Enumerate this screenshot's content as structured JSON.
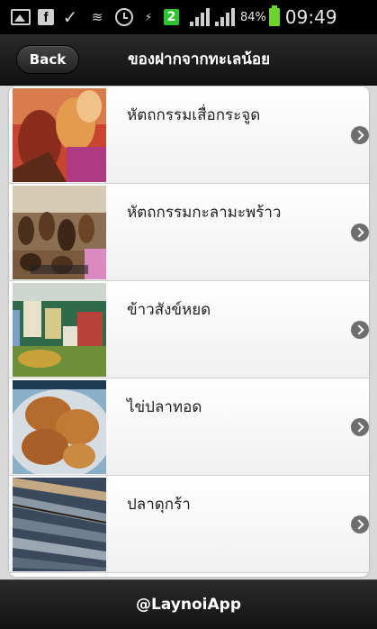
{
  "status_bar": {
    "icons": [
      "gallery-icon",
      "facebook-icon",
      "check-icon",
      "wifi-icon",
      "alarm-icon",
      "charging-icon",
      "notification-2-icon",
      "signal-icon",
      "signal-icon"
    ],
    "notification_count": "2",
    "fb_glyph": "f",
    "battery_percent": "84%",
    "time": "09:49"
  },
  "header": {
    "back_label": "Back",
    "title": "ของฝากจากทะเลน้อย"
  },
  "items": [
    {
      "label": "หัตถกรรมเสื่อกระจูด",
      "thumb": "woven-crafts"
    },
    {
      "label": "หัตถกรรมกะลามะพร้าว",
      "thumb": "coconut-shell-crafts"
    },
    {
      "label": "ข้าวสังข์หยด",
      "thumb": "rice-bags"
    },
    {
      "label": "ไข่ปลาทอด",
      "thumb": "fried-fish-eggs"
    },
    {
      "label": "ปลาดุกร้า",
      "thumb": "salted-catfish"
    }
  ],
  "footer": {
    "label": "@LaynoiApp"
  },
  "colors": {
    "statusbar_bg": "#000000",
    "header_bg": "#1a1a1a",
    "list_bg": "#ffffff",
    "chevron": "#6e6e6e",
    "battery": "#6bd427",
    "notification_badge": "#2ec42e"
  }
}
